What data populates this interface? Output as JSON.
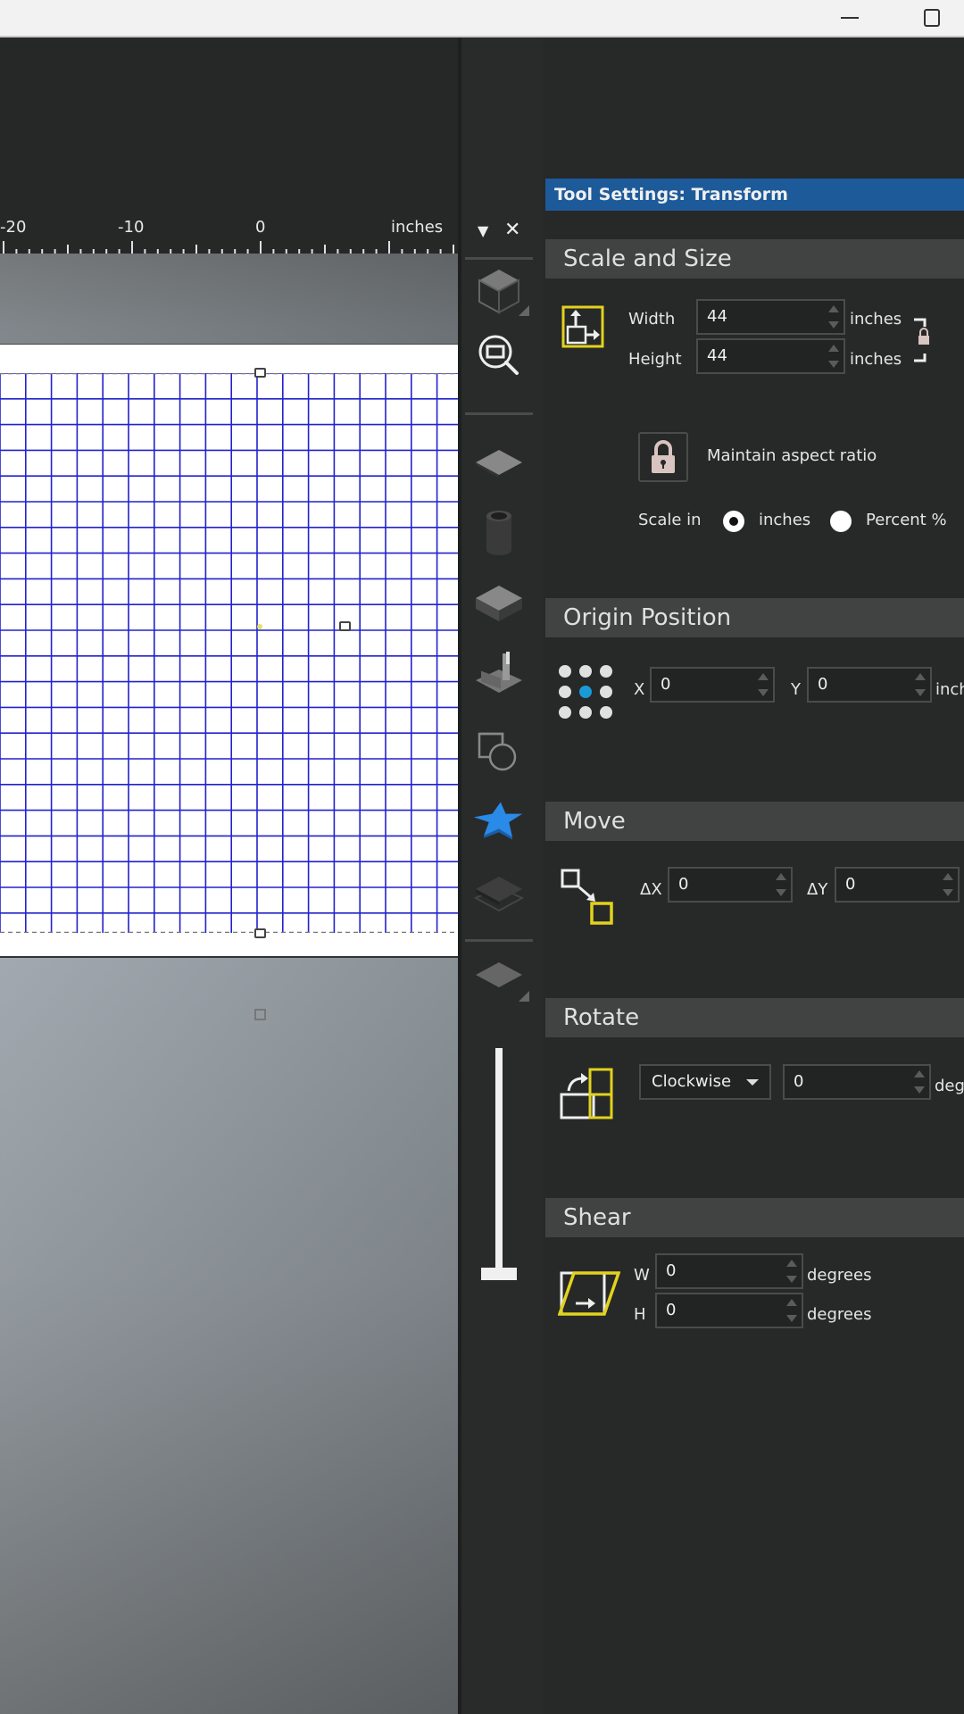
{
  "window": {
    "minimize_icon": "minimize-icon",
    "maximize_icon": "maximize-icon"
  },
  "ruler": {
    "labels": [
      "-20",
      "-10",
      "0"
    ],
    "unit": "inches"
  },
  "toolstrip": {
    "collapse_glyph": "▼",
    "close_glyph": "✕",
    "tools": [
      {
        "name": "view-cube-tool",
        "icon": "cube-icon"
      },
      {
        "name": "zoom-fit-tool",
        "icon": "zoom-extents-icon"
      },
      {
        "name": "flat-sheet-tool",
        "icon": "flat-plane-icon"
      },
      {
        "name": "cylinder-tool",
        "icon": "cylinder-icon"
      },
      {
        "name": "box-tool",
        "icon": "box-icon"
      },
      {
        "name": "machine-tool",
        "icon": "machine-icon"
      },
      {
        "name": "shape-tool",
        "icon": "shapes-icon"
      },
      {
        "name": "star-tool",
        "icon": "star-icon",
        "active": true
      },
      {
        "name": "layers-tool",
        "icon": "layers-icon"
      },
      {
        "name": "plane-tool",
        "icon": "plane-icon"
      }
    ],
    "slider_value": 0
  },
  "panel": {
    "title": "Tool Settings: Transform",
    "scale_size": {
      "header": "Scale and Size",
      "width_label": "Width",
      "width_value": "44",
      "height_label": "Height",
      "height_value": "44",
      "unit": "inches",
      "maintain_label": "Maintain aspect ratio",
      "scale_in_label": "Scale in",
      "option_inches": "inches",
      "option_percent": "Percent %",
      "selected": "inches"
    },
    "origin": {
      "header": "Origin Position",
      "x_label": "X",
      "x_value": "0",
      "y_label": "Y",
      "y_value": "0",
      "unit": "inches"
    },
    "move": {
      "header": "Move",
      "dx_label": "ΔX",
      "dx_value": "0",
      "dy_label": "ΔY",
      "dy_value": "0"
    },
    "rotate": {
      "header": "Rotate",
      "direction": "Clockwise",
      "value": "0",
      "unit": "degrees"
    },
    "shear": {
      "header": "Shear",
      "w_label": "W",
      "w_value": "0",
      "h_label": "H",
      "h_value": "0",
      "unit": "degrees"
    }
  },
  "colors": {
    "accent_blue": "#1d5a9a",
    "grid_blue": "#2222cc",
    "icon_yellow": "#e2d21e",
    "active_tool": "#2a8ae8",
    "origin_dot_active": "#1a9ad6"
  }
}
